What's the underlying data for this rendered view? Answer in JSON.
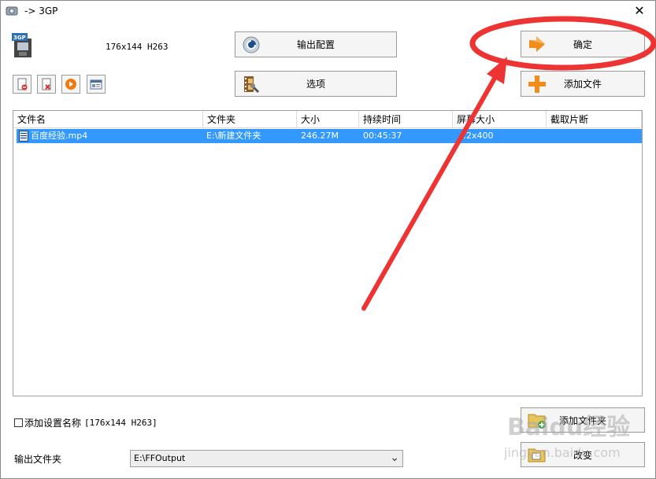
{
  "window": {
    "title": "-> 3GP",
    "close_glyph": "✕"
  },
  "preset": {
    "label": "176x144 H263",
    "icon": "3gp-format-icon",
    "icon_text": "3GP"
  },
  "buttons": {
    "output_config": "输出配置",
    "options": "选项",
    "ok": "确定",
    "add_file": "添加文件",
    "add_folder": "添加文件夹",
    "change": "改变"
  },
  "toolbar": {
    "items": [
      "remove-file-icon",
      "clear-list-icon",
      "play-icon",
      "media-info-icon"
    ]
  },
  "file_list": {
    "columns": [
      "文件名",
      "文件夹",
      "大小",
      "持续时间",
      "屏幕大小",
      "截取片断"
    ],
    "rows": [
      {
        "name": "百度经验.mp4",
        "folder": "E:\\新建文件夹",
        "size": "246.27M",
        "duration": "00:45:37",
        "screen": "…2x400",
        "clip": ""
      }
    ]
  },
  "footer": {
    "add_setting_label": "添加设置名称",
    "add_setting_preset": "[176x144 H263]",
    "output_folder_label": "输出文件夹",
    "output_folder_value": "E:\\FFOutput"
  },
  "watermark": {
    "main": "Baidu经验",
    "sub": "jingyan.baidu.com"
  },
  "colors": {
    "selection": "#3399ff",
    "annotation": "#ee3333",
    "add_orange": "#f28c1a"
  }
}
